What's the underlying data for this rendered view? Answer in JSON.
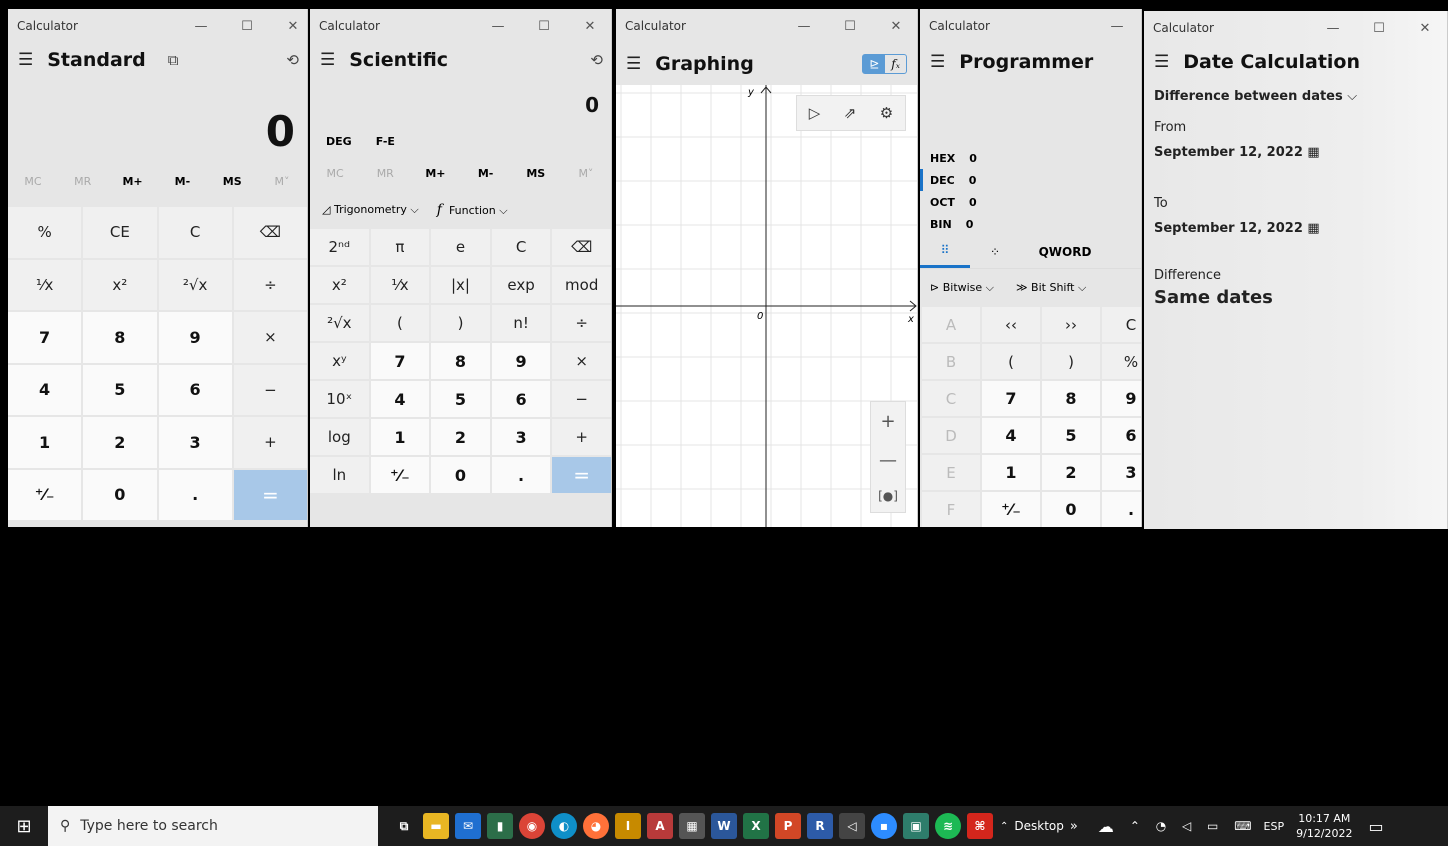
{
  "app_title": "Calculator",
  "window_controls": {
    "minimize": "—",
    "maximize": "☐",
    "close": "✕"
  },
  "standard": {
    "mode": "Standard",
    "display": "0",
    "memory": [
      "MC",
      "MR",
      "M+",
      "M-",
      "MS",
      "M˅"
    ],
    "keys": [
      "%",
      "CE",
      "C",
      "⌫",
      "¹⁄x",
      "x²",
      "²√x",
      "÷",
      "7",
      "8",
      "9",
      "×",
      "4",
      "5",
      "6",
      "−",
      "1",
      "2",
      "3",
      "+",
      "⁺⁄₋",
      "0",
      ".",
      "="
    ]
  },
  "scientific": {
    "mode": "Scientific",
    "display": "0",
    "deg": "DEG",
    "fe": "F-E",
    "memory": [
      "MC",
      "MR",
      "M+",
      "M-",
      "MS",
      "M˅"
    ],
    "trig": "Trigonometry",
    "func": "Function",
    "keys": [
      "2ⁿᵈ",
      "π",
      "e",
      "C",
      "⌫",
      "x²",
      "¹⁄x",
      "|x|",
      "exp",
      "mod",
      "²√x",
      "(",
      ")",
      "n!",
      "÷",
      "xʸ",
      "7",
      "8",
      "9",
      "×",
      "10ˣ",
      "4",
      "5",
      "6",
      "−",
      "log",
      "1",
      "2",
      "3",
      "+",
      "ln",
      "⁺⁄₋",
      "0",
      ".",
      "="
    ]
  },
  "graphing": {
    "mode": "Graphing",
    "y_axis": "y",
    "x_axis": "x",
    "origin": "0",
    "zoom_in": "+",
    "zoom_out": "—"
  },
  "programmer": {
    "mode": "Programmer",
    "bases": [
      {
        "label": "HEX",
        "value": "0"
      },
      {
        "label": "DEC",
        "value": "0"
      },
      {
        "label": "OCT",
        "value": "0"
      },
      {
        "label": "BIN",
        "value": "0"
      }
    ],
    "word": "QWORD",
    "bitwise": "Bitwise",
    "bitshift": "Bit Shift",
    "keys": [
      "A",
      "‹‹",
      "››",
      "C",
      "B",
      "(",
      ")",
      "%",
      "C",
      "7",
      "8",
      "9",
      "D",
      "4",
      "5",
      "6",
      "E",
      "1",
      "2",
      "3",
      "F",
      "⁺⁄₋",
      "0",
      "."
    ]
  },
  "date": {
    "mode": "Date Calculation",
    "selector": "Difference between dates",
    "from_label": "From",
    "from_date": "September 12, 2022",
    "to_label": "To",
    "to_date": "September 12, 2022",
    "difference_label": "Difference",
    "difference_value": "Same dates"
  },
  "taskbar": {
    "search_placeholder": "Type here to search",
    "desktop": "Desktop",
    "lang": "ESP",
    "time": "10:17 AM",
    "date": "9/12/2022"
  }
}
